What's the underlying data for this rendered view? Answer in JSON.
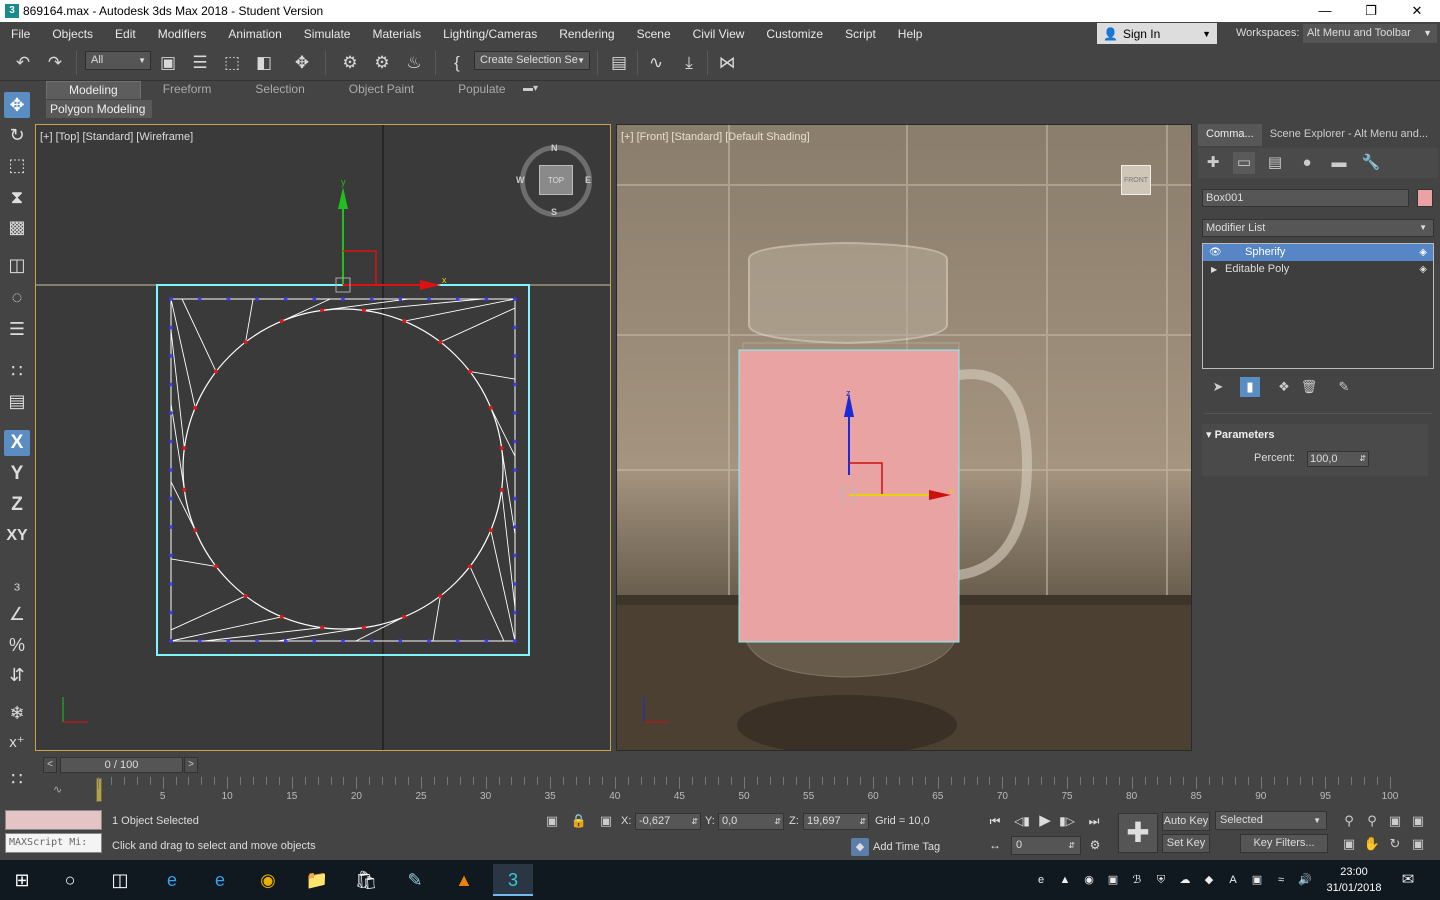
{
  "window": {
    "title": "869164.max - Autodesk 3ds Max 2018 - Student Version",
    "app_icon": "3",
    "controls": [
      "minimize-icon",
      "maximize-icon",
      "close-icon"
    ]
  },
  "menu": {
    "items": [
      "File",
      "Objects",
      "Edit",
      "Modifiers",
      "Animation",
      "Simulate",
      "Materials",
      "Lighting/Cameras",
      "Rendering",
      "Scene",
      "Civil View",
      "Customize",
      "Script",
      "Help"
    ],
    "sign_in": "Sign In",
    "workspaces_label": "Workspaces:",
    "workspace_value": "Alt Menu and Toolbar"
  },
  "toolbar": {
    "selection_filter": "All",
    "named_selection": "Create Selection Se"
  },
  "ribbon": {
    "tabs": [
      "Modeling",
      "Freeform",
      "Selection",
      "Object Paint",
      "Populate"
    ],
    "active_tab": "Modeling",
    "sub_panel": "Polygon Modeling"
  },
  "left_strip": {
    "letters": [
      "X",
      "Y",
      "Z",
      "XY"
    ]
  },
  "viewports": {
    "left_label": "[+] [Top] [Standard] [Wireframe]",
    "right_label": "[+] [Front] [Standard] [Default Shading]",
    "viewcube_top": "TOP",
    "viewcube_front": "FRONT",
    "compass": {
      "n": "N",
      "s": "S",
      "e": "E",
      "w": "W"
    },
    "axis_y": "y",
    "axis_x": "x",
    "axis_z": "z"
  },
  "command_panel": {
    "tabs": [
      "Comma...",
      "Scene Explorer - Alt Menu and..."
    ],
    "object_name": "Box001",
    "object_color": "#e8a3a2",
    "modifier_list": "Modifier List",
    "stack": [
      {
        "name": "Spherify",
        "selected": true
      },
      {
        "name": "Editable Poly",
        "selected": false
      }
    ],
    "rollout_title": "Parameters",
    "param_label": "Percent:",
    "param_value": "100,0"
  },
  "time": {
    "frame_display": "0 / 100",
    "prev": "<",
    "next": ">",
    "ticks": [
      5,
      10,
      15,
      20,
      25,
      30,
      35,
      40,
      45,
      50,
      55,
      60,
      65,
      70,
      75,
      80,
      85,
      90,
      95,
      100
    ]
  },
  "status": {
    "selected_count": "1 Object Selected",
    "prompt": "Click and drag to select and move objects",
    "maxscript_placeholder": "MAXScript Mi:",
    "x_label": "X:",
    "x_value": "-0,627",
    "y_label": "Y:",
    "y_value": "0,0",
    "z_label": "Z:",
    "z_value": "19,697",
    "grid": "Grid = 10,0",
    "add_time_tag": "Add Time Tag",
    "auto_key": "Auto Key",
    "set_key": "Set Key",
    "key_mode": "Selected",
    "key_filters": "Key Filters...",
    "current_frame": "0"
  },
  "taskbar": {
    "time": "23:00",
    "date": "31/01/2018"
  },
  "colors": {
    "viewport_border_active": "#c9a24a",
    "selection_highlight": "#5686c5",
    "box_color": "#e8a3a2",
    "wire_selected": "#7ff6ff"
  }
}
